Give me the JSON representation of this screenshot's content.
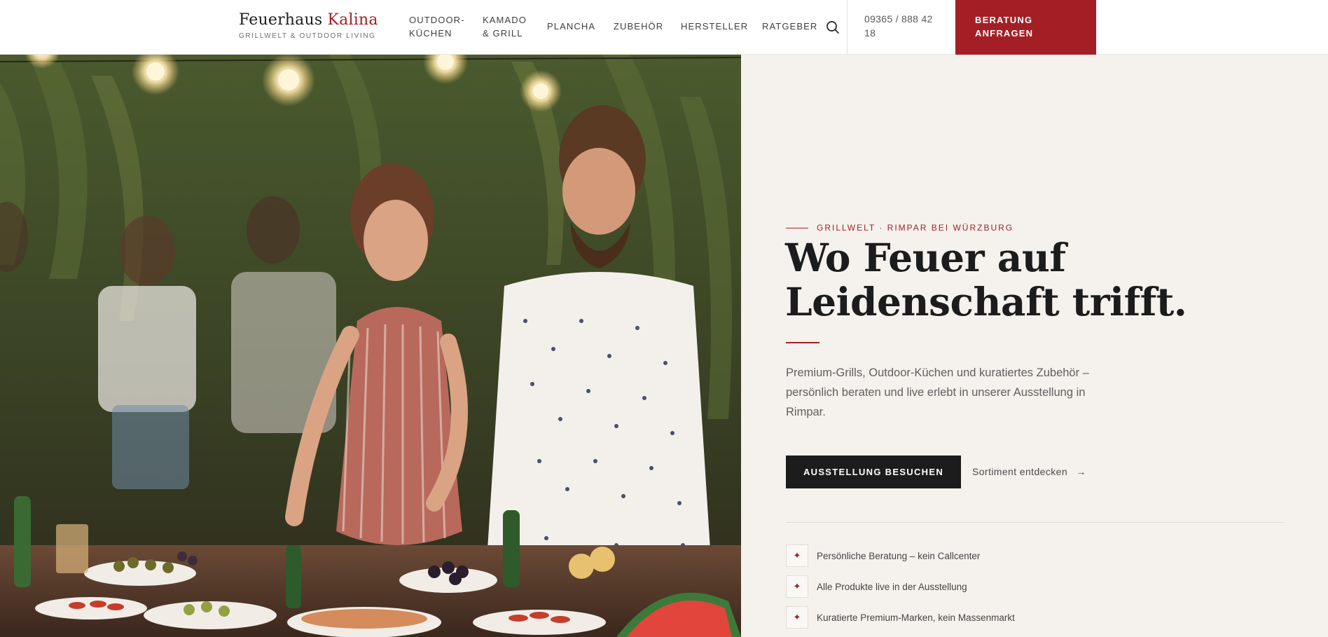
{
  "brand": {
    "name_primary": "Feuerhaus",
    "name_accent": "Kalina",
    "tagline": "GRILLWELT & OUTDOOR LIVING"
  },
  "nav": [
    {
      "line1": "OUTDOOR-",
      "line2": "KÜCHEN"
    },
    {
      "line1": "KAMADO",
      "line2": "& GRILL"
    },
    {
      "line1": "PLANCHA",
      "line2": ""
    },
    {
      "line1": "ZUBEHÖR",
      "line2": ""
    },
    {
      "line1": "HERSTELLER",
      "line2": ""
    },
    {
      "line1": "RATGEBER",
      "line2": ""
    }
  ],
  "header": {
    "phone": "09365 / 888 42 18",
    "cta_line1": "BERATUNG",
    "cta_line2": "ANFRAGEN"
  },
  "hero": {
    "eyebrow": "GRILLWELT · RIMPAR BEI WÜRZBURG",
    "headline_line1": "Wo Feuer auf",
    "headline_line2": "Leidenschaft trifft.",
    "lead": "Premium-Grills, Outdoor-Küchen und kuratiertes Zubehör – persönlich beraten und live erlebt in unserer Ausstellung in Rimpar.",
    "primary_button": "AUSSTELLUNG BESUCHEN",
    "secondary_link": "Sortiment entdecken",
    "secondary_arrow": "→"
  },
  "features": [
    {
      "icon": "sparkle-icon",
      "glyph": "✦",
      "text": "Persönliche Beratung – kein Callcenter"
    },
    {
      "icon": "sparkle-icon",
      "glyph": "✦",
      "text": "Alle Produkte live in der Ausstellung"
    },
    {
      "icon": "sparkle-icon",
      "glyph": "✦",
      "text": "Kuratierte Premium-Marken, kein Massenmarkt"
    }
  ],
  "colors": {
    "accent": "#a31f25",
    "dark": "#1c1c1c",
    "background": "#f5f2ed"
  }
}
